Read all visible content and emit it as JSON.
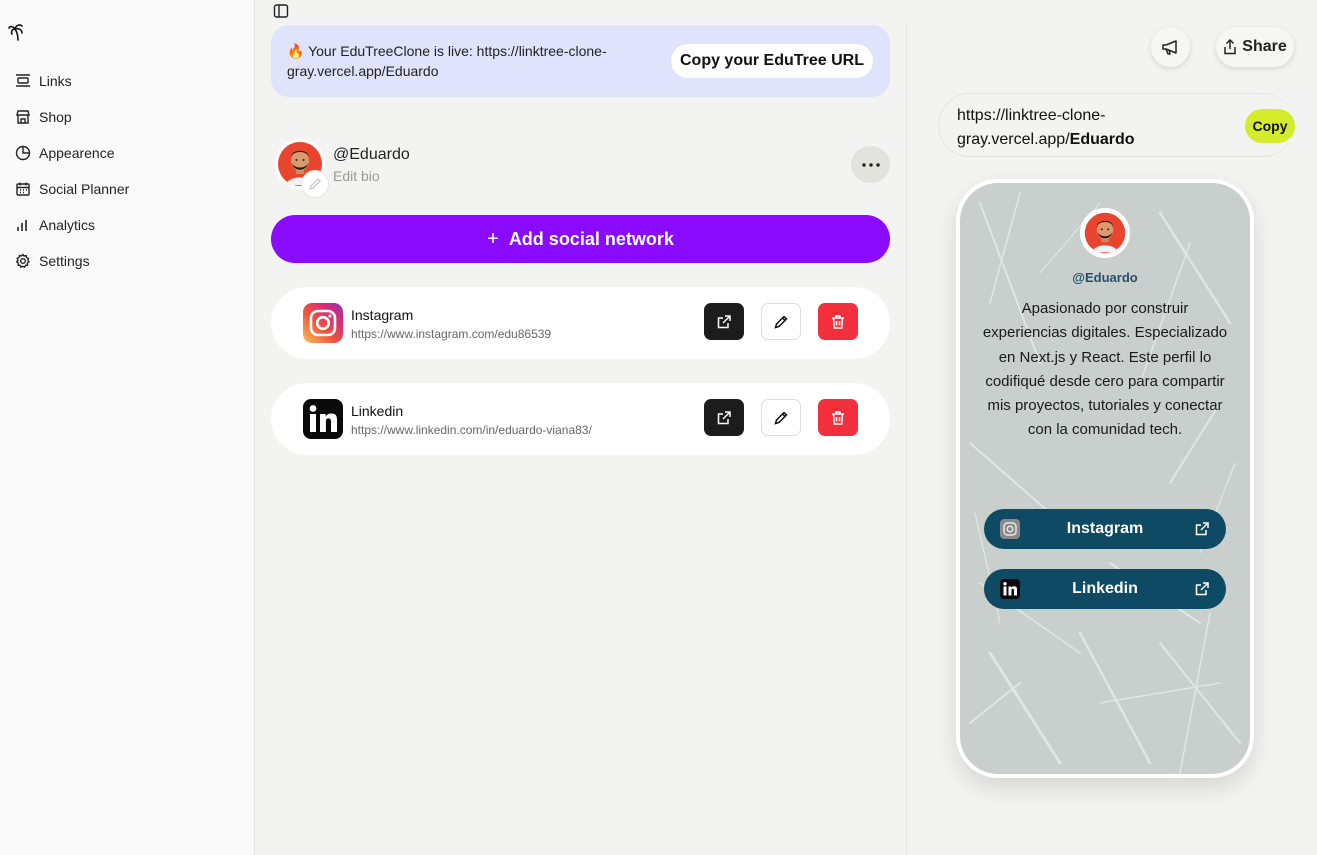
{
  "sidebar": {
    "items": [
      {
        "label": "Links",
        "icon": "links-icon"
      },
      {
        "label": "Shop",
        "icon": "shop-icon"
      },
      {
        "label": "Appearence",
        "icon": "palette-icon"
      },
      {
        "label": "Social Planner",
        "icon": "calendar-icon"
      },
      {
        "label": "Analytics",
        "icon": "chart-icon"
      },
      {
        "label": "Settings",
        "icon": "gear-icon"
      }
    ]
  },
  "banner": {
    "text": "🔥 Your EduTreeClone is live: https://linktree-clone-gray.vercel.app/Eduardo",
    "button": "Copy your EduTree URL"
  },
  "profile": {
    "handle": "@Eduardo",
    "edit_bio": "Edit bio"
  },
  "add_button": {
    "plus": "+",
    "label": "Add social network"
  },
  "links": [
    {
      "title": "Instagram",
      "url": "https://www.instagram.com/edu86539"
    },
    {
      "title": "Linkedin",
      "url": "https://www.linkedin.com/in/eduardo-viana83/"
    }
  ],
  "preview": {
    "share_label": "Share",
    "url_prefix": "https://linktree-clone-gray.vercel.app/",
    "url_user": "Eduardo",
    "copy_label": "Copy",
    "handle": "@Eduardo",
    "bio": "Apasionado por construir experiencias digitales. Especializado en Next.js y React. Este perfil lo codifiqué desde cero para compartir mis proyectos, tutoriales y conectar con la comunidad tech.",
    "links": [
      {
        "label": "Instagram"
      },
      {
        "label": "Linkedin"
      }
    ]
  },
  "colors": {
    "accent_purple": "#8a0bff",
    "copy_lime": "#d4ec2c",
    "delete_red": "#f2303d",
    "preview_button": "#0e4a63",
    "banner_bg": "#dfe3fb"
  }
}
